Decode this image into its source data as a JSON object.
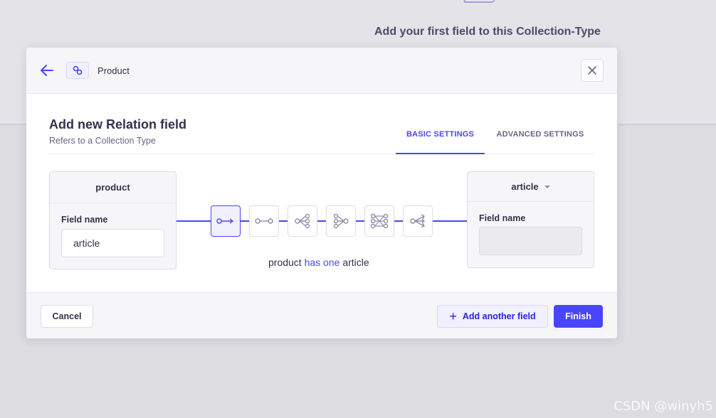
{
  "background": {
    "heading": "Add your first field to this Collection-Type"
  },
  "modal": {
    "header": {
      "back_icon": "arrow-left-icon",
      "type_icon": "link-icon",
      "title": "Product",
      "close_icon": "close-icon"
    },
    "title": "Add new Relation field",
    "subtitle": "Refers to a Collection Type",
    "tabs": [
      {
        "label": "BASIC SETTINGS",
        "active": true
      },
      {
        "label": "ADVANCED SETTINGS",
        "active": false
      }
    ],
    "left_card": {
      "name": "product",
      "field_label": "Field name",
      "field_value": "article"
    },
    "right_card": {
      "name": "article",
      "field_label": "Field name",
      "field_value": ""
    },
    "relation_types": [
      {
        "icon": "one-way-relation-icon",
        "active": true
      },
      {
        "icon": "one-to-one-relation-icon",
        "active": false
      },
      {
        "icon": "one-to-many-relation-icon",
        "active": false
      },
      {
        "icon": "many-to-one-relation-icon",
        "active": false
      },
      {
        "icon": "many-to-many-relation-icon",
        "active": false
      },
      {
        "icon": "many-way-relation-icon",
        "active": false
      }
    ],
    "relation_description": {
      "prefix": "product",
      "highlight": "has one",
      "suffix": "article"
    },
    "footer": {
      "cancel_label": "Cancel",
      "add_label": "Add another field",
      "finish_label": "Finish"
    }
  },
  "colors": {
    "accent": "#4945ff",
    "neutral_bg": "#f6f6f9"
  },
  "watermark": "CSDN @winyh5"
}
